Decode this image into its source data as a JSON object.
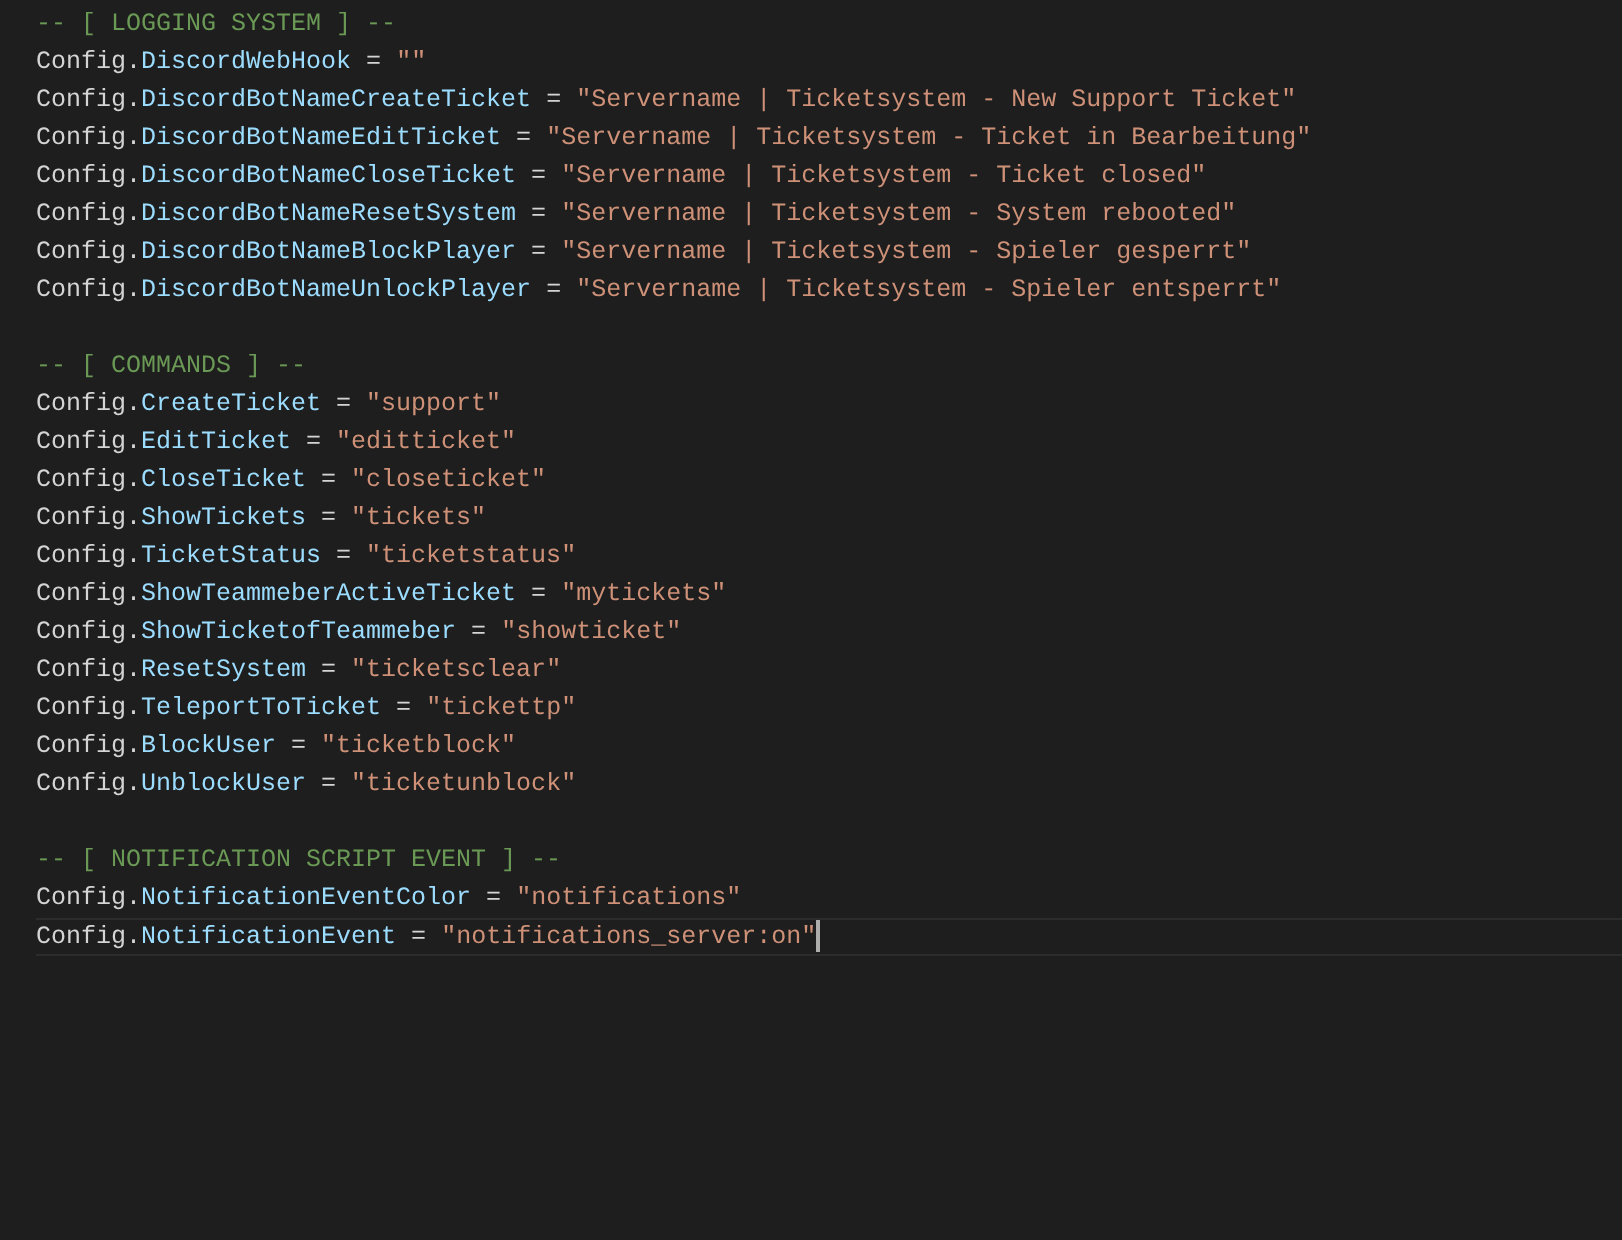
{
  "editor": {
    "sections": [
      {
        "comment": "-- [ LOGGING SYSTEM ] --",
        "lines": [
          {
            "object": "Config.",
            "key": "DiscordWebHook",
            "operator": "=",
            "value": "\"\"",
            "current": false
          },
          {
            "object": "Config.",
            "key": "DiscordBotNameCreateTicket",
            "operator": "=",
            "value": "\"Servername | Ticketsystem - New Support Ticket\"",
            "current": false
          },
          {
            "object": "Config.",
            "key": "DiscordBotNameEditTicket",
            "operator": "=",
            "value": "\"Servername | Ticketsystem - Ticket in Bearbeitung\"",
            "current": false
          },
          {
            "object": "Config.",
            "key": "DiscordBotNameCloseTicket",
            "operator": "=",
            "value": "\"Servername | Ticketsystem - Ticket closed\"",
            "current": false
          },
          {
            "object": "Config.",
            "key": "DiscordBotNameResetSystem",
            "operator": "=",
            "value": "\"Servername | Ticketsystem - System rebooted\"",
            "current": false
          },
          {
            "object": "Config.",
            "key": "DiscordBotNameBlockPlayer",
            "operator": "=",
            "value": "\"Servername | Ticketsystem - Spieler gesperrt\"",
            "current": false
          },
          {
            "object": "Config.",
            "key": "DiscordBotNameUnlockPlayer",
            "operator": "=",
            "value": "\"Servername | Ticketsystem - Spieler entsperrt\"",
            "current": false
          }
        ]
      },
      {
        "comment": "-- [ COMMANDS ] --",
        "lines": [
          {
            "object": "Config.",
            "key": "CreateTicket",
            "operator": "=",
            "value": "\"support\"",
            "current": false
          },
          {
            "object": "Config.",
            "key": "EditTicket",
            "operator": "=",
            "value": "\"editticket\"",
            "current": false
          },
          {
            "object": "Config.",
            "key": "CloseTicket",
            "operator": "=",
            "value": "\"closeticket\"",
            "current": false
          },
          {
            "object": "Config.",
            "key": "ShowTickets",
            "operator": "=",
            "value": "\"tickets\"",
            "current": false
          },
          {
            "object": "Config.",
            "key": "TicketStatus",
            "operator": "=",
            "value": "\"ticketstatus\"",
            "current": false
          },
          {
            "object": "Config.",
            "key": "ShowTeammeberActiveTicket",
            "operator": "=",
            "value": "\"mytickets\"",
            "current": false
          },
          {
            "object": "Config.",
            "key": "ShowTicketofTeammeber",
            "operator": "=",
            "value": "\"showticket\"",
            "current": false
          },
          {
            "object": "Config.",
            "key": "ResetSystem",
            "operator": "=",
            "value": "\"ticketsclear\"",
            "current": false
          },
          {
            "object": "Config.",
            "key": "TeleportToTicket",
            "operator": "=",
            "value": "\"tickettp\"",
            "current": false
          },
          {
            "object": "Config.",
            "key": "BlockUser",
            "operator": "=",
            "value": "\"ticketblock\"",
            "current": false
          },
          {
            "object": "Config.",
            "key": "UnblockUser",
            "operator": "=",
            "value": "\"ticketunblock\"",
            "current": false
          }
        ]
      },
      {
        "comment": "-- [ NOTIFICATION SCRIPT EVENT ] --",
        "lines": [
          {
            "object": "Config.",
            "key": "NotificationEventColor",
            "operator": "=",
            "value": "\"notifications\"",
            "current": false
          },
          {
            "object": "Config.",
            "key": "NotificationEvent",
            "operator": "=",
            "value": "\"notifications_server:on\"",
            "current": true
          }
        ]
      }
    ]
  }
}
